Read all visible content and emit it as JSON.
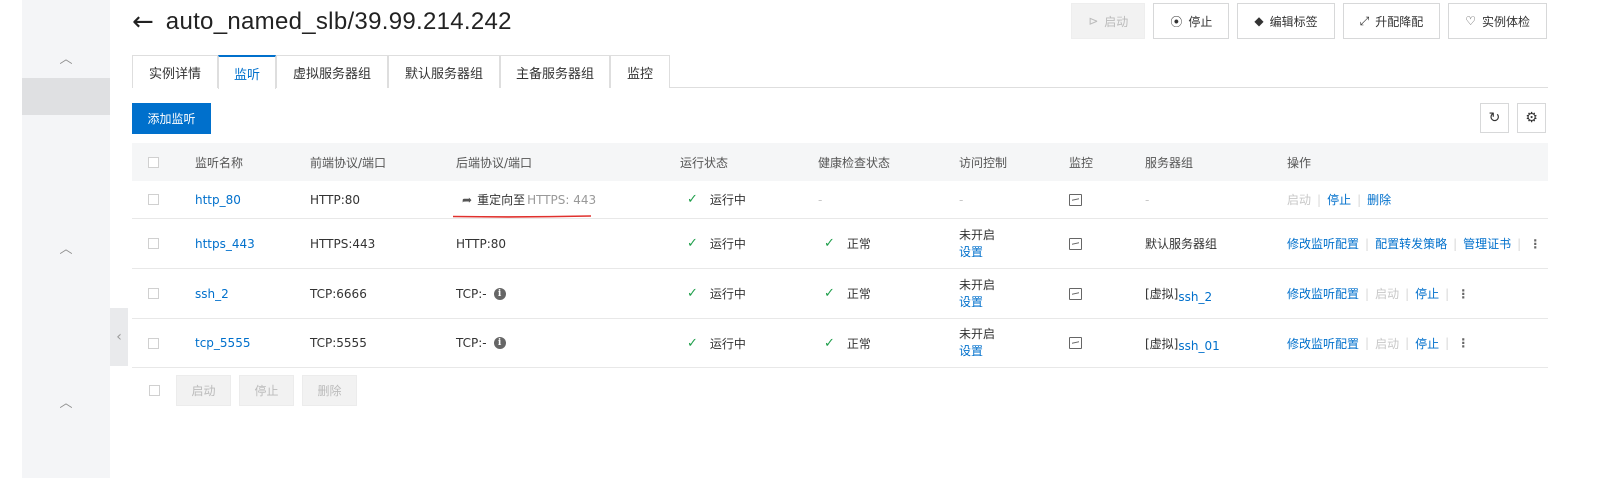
{
  "header": {
    "back_icon": "arrow-left-icon",
    "title": "auto_named_slb/39.99.214.242",
    "actions": [
      {
        "label": "启动",
        "icon": "play-circle-icon",
        "disabled": true
      },
      {
        "label": "停止",
        "icon": "stop-circle-icon",
        "disabled": false
      },
      {
        "label": "编辑标签",
        "icon": "tag-icon",
        "disabled": false
      },
      {
        "label": "升配降配",
        "icon": "resize-icon",
        "disabled": false
      },
      {
        "label": "实例体检",
        "icon": "health-check-icon",
        "disabled": false
      }
    ]
  },
  "tabs": [
    {
      "label": "实例详情",
      "active": false
    },
    {
      "label": "监听",
      "active": true
    },
    {
      "label": "虚拟服务器组",
      "active": false
    },
    {
      "label": "默认服务器组",
      "active": false
    },
    {
      "label": "主备服务器组",
      "active": false
    },
    {
      "label": "监控",
      "active": false
    }
  ],
  "toolbar": {
    "add_label": "添加监听",
    "refresh_icon": "refresh-icon",
    "settings_icon": "gear-icon"
  },
  "table": {
    "columns": [
      "监听名称",
      "前端协议/端口",
      "后端协议/端口",
      "运行状态",
      "健康检查状态",
      "访问控制",
      "监控",
      "服务器组",
      "操作"
    ],
    "rows": [
      {
        "name": "http_80",
        "frontend": "HTTP:80",
        "backend_prefix": "重定向至",
        "backend": "HTTPS: 443",
        "backend_redirect": true,
        "status": "运行中",
        "health": "-",
        "acl": "-",
        "acl_set": "",
        "server_group_prefix": "",
        "server_group": "-",
        "ops": [
          "启动",
          "停止",
          "删除"
        ]
      },
      {
        "name": "https_443",
        "frontend": "HTTPS:443",
        "backend_prefix": "",
        "backend": "HTTP:80",
        "backend_redirect": false,
        "status": "运行中",
        "health": "正常",
        "acl": "未开启",
        "acl_set": "设置",
        "server_group_prefix": "",
        "server_group": "默认服务器组",
        "ops": [
          "修改监听配置",
          "配置转发策略",
          "管理证书"
        ]
      },
      {
        "name": "ssh_2",
        "frontend": "TCP:6666",
        "backend_prefix": "",
        "backend": "TCP:-",
        "backend_redirect": false,
        "status": "运行中",
        "health": "正常",
        "acl": "未开启",
        "acl_set": "设置",
        "server_group_prefix": "[虚拟]",
        "server_group": "ssh_2",
        "ops": [
          "修改监听配置",
          "启动",
          "停止"
        ]
      },
      {
        "name": "tcp_5555",
        "frontend": "TCP:5555",
        "backend_prefix": "",
        "backend": "TCP:-",
        "backend_redirect": false,
        "status": "运行中",
        "health": "正常",
        "acl": "未开启",
        "acl_set": "设置",
        "server_group_prefix": "[虚拟]",
        "server_group": "ssh_01",
        "ops": [
          "修改监听配置",
          "启动",
          "停止"
        ]
      }
    ]
  },
  "bulk_actions": [
    "启动",
    "停止",
    "删除"
  ],
  "colors": {
    "accent": "#0070cc",
    "success": "#1e9e4a",
    "annotation": "#e0312d"
  }
}
